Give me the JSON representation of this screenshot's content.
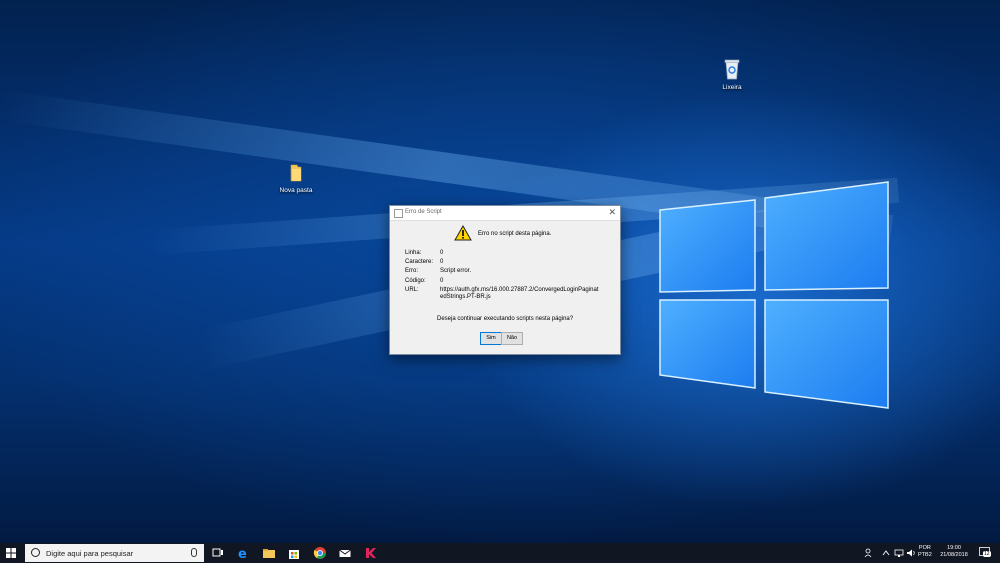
{
  "desktop": {
    "icons": [
      {
        "label": "Lixeira",
        "icon": "recycle-bin-icon"
      },
      {
        "label": "Nova pasta",
        "icon": "folder-icon"
      }
    ]
  },
  "dialog": {
    "title": "Erro de Script",
    "headline": "Erro no script desta página.",
    "fields": [
      {
        "key": "Linha:",
        "value": "0"
      },
      {
        "key": "Caractere:",
        "value": "0"
      },
      {
        "key": "Erro:",
        "value": "Script error."
      },
      {
        "key": "Código:",
        "value": "0"
      },
      {
        "key": "URL:",
        "value": "https://auth.gfx.ms/16.000.27887.2/ConvergedLoginPaginatedStrings.PT-BR.js"
      }
    ],
    "question": "Deseja continuar executando scripts nesta página?",
    "buttons": {
      "yes": "Sim",
      "no": "Não"
    },
    "close_symbol": "✕"
  },
  "taskbar": {
    "search_placeholder": "Digite aqui para pesquisar",
    "pinned": [
      "task-view-icon",
      "edge-icon",
      "file-explorer-icon",
      "store-icon",
      "chrome-icon",
      "mail-icon",
      "kaspersky-icon"
    ],
    "lang_line1": "POR",
    "lang_line2": "PTB2",
    "time": "19:00",
    "date": "21/08/2018",
    "notification_count": "12"
  },
  "colors": {
    "accent": "#0078d7",
    "taskbar": "#101622"
  }
}
